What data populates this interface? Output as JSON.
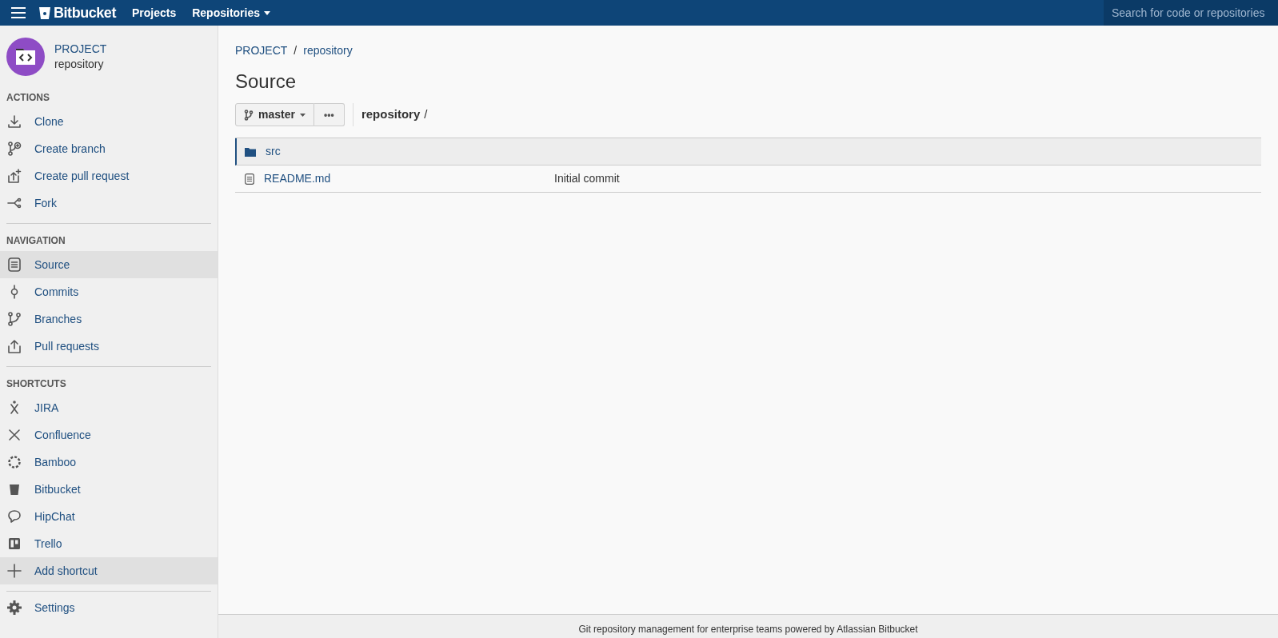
{
  "header": {
    "logo": "Bitbucket",
    "menu": [
      {
        "label": "Projects",
        "dropdown": false
      },
      {
        "label": "Repositories",
        "dropdown": true
      }
    ],
    "search": {
      "placeholder": "Search for code or repositories"
    }
  },
  "sidebar": {
    "project": "PROJECT",
    "repository": "repository",
    "sections": [
      {
        "heading": "ACTIONS",
        "items": [
          {
            "label": "Clone",
            "selected": false
          },
          {
            "label": "Create branch",
            "selected": false
          },
          {
            "label": "Create pull request",
            "selected": false
          },
          {
            "label": "Fork",
            "selected": false
          }
        ]
      },
      {
        "heading": "NAVIGATION",
        "items": [
          {
            "label": "Source",
            "selected": true
          },
          {
            "label": "Commits",
            "selected": false
          },
          {
            "label": "Branches",
            "selected": false
          },
          {
            "label": "Pull requests",
            "selected": false
          }
        ]
      },
      {
        "heading": "SHORTCUTS",
        "items": [
          {
            "label": "JIRA",
            "selected": false
          },
          {
            "label": "Confluence",
            "selected": false
          },
          {
            "label": "Bamboo",
            "selected": false
          },
          {
            "label": "Bitbucket",
            "selected": false
          },
          {
            "label": "HipChat",
            "selected": false
          },
          {
            "label": "Trello",
            "selected": false
          },
          {
            "label": "Add shortcut",
            "selected": true
          }
        ]
      }
    ],
    "footer_item": {
      "label": "Settings"
    }
  },
  "main": {
    "breadcrumbs": [
      "PROJECT",
      "repository"
    ],
    "breadcrumb_separator": "/",
    "title": "Source",
    "branch": "master",
    "more": "•••",
    "path": "repository",
    "path_separator": "/",
    "files": [
      {
        "kind": "folder",
        "name": "src",
        "selected": true
      },
      {
        "kind": "file",
        "name": "README.md",
        "message": "Initial commit",
        "selected": false
      }
    ]
  },
  "footer": "Git repository management for enterprise teams powered by Atlassian Bitbucket"
}
